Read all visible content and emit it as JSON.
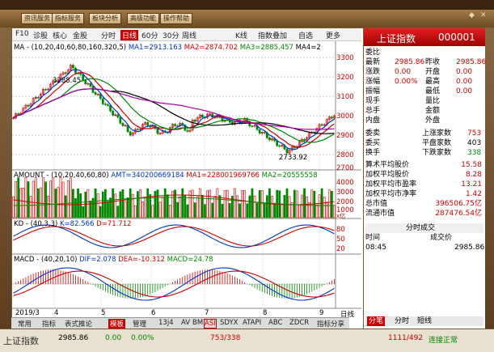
{
  "menu": [
    "资讯服务",
    "指标服务",
    "板块分析",
    "高级功能",
    "操作帮助"
  ],
  "toolbar": {
    "items": [
      "F10",
      "诊股",
      "核心",
      "金股",
      "分时",
      "日线",
      "60分",
      "30分",
      "周线",
      "K线",
      "指数叠加",
      "自选",
      "更多"
    ],
    "selected": "日线"
  },
  "ma_line": {
    "label": "MA - (10,20,40,60,80,160,320,5)",
    "ma1": "MA1=2913.163",
    "ma2": "MA2=2874.702",
    "ma3": "MA3=2885.457",
    "ma4": "MA4=2"
  },
  "price_axis": [
    "3300",
    "3200",
    "3100",
    "3000",
    "2900",
    "2800",
    "2700"
  ],
  "high_label": "3288.45",
  "low_label": "2733.92",
  "amount_line": {
    "label": "AMOUNT - (10,20,40,60,80)",
    "amt": "AMT=340200669184",
    "ma1": "MA1=228001969766",
    "ma2": "MA2=20555558"
  },
  "amount_axis": [
    "4000",
    "3000",
    "2000",
    "1000",
    "x亿"
  ],
  "kd_line": {
    "label": "KD - (40,3,3)",
    "k": "K=82.566",
    "d": "D=71.712"
  },
  "kd_axis": [
    "80",
    "50",
    "20"
  ],
  "macd_line": {
    "label": "MACD - (40,20,10)",
    "dif": "DIF=2.078",
    "dea": "DEA=-10.312",
    "macd": "MACD=24.78"
  },
  "x_labels": [
    "2019/3",
    "4",
    "5",
    "6",
    "7",
    "8",
    "9"
  ],
  "x_unit": "日线",
  "quote": {
    "title": "上证指数",
    "code": "000001",
    "weibi": "委比",
    "rows": [
      {
        "l1": "最新",
        "v1": "2985.86",
        "l2": "昨收",
        "v2": "2985.86"
      },
      {
        "l1": "涨跌",
        "v1": "0.00",
        "l2": "开盘",
        "v2": "0.00"
      },
      {
        "l1": "涨幅",
        "v1": "0.00%",
        "l2": "最高",
        "v2": "0.00"
      },
      {
        "l1": "振幅",
        "v1": "",
        "l2": "最低",
        "v2": "0.00"
      },
      {
        "l1": "现手",
        "v1": "",
        "l2": "量比",
        "v2": ""
      },
      {
        "l1": "总手",
        "v1": "",
        "l2": "金额",
        "v2": ""
      },
      {
        "l1": "内盘",
        "v1": "",
        "l2": "外盘",
        "v2": ""
      }
    ],
    "breadth": [
      {
        "l1": "委卖",
        "l2": "上涨家数",
        "v2": "753"
      },
      {
        "l1": "委买",
        "l2": "平盘家数",
        "v2": "403"
      },
      {
        "l1": "换手",
        "l2": "下跌家数",
        "v2": "338"
      }
    ],
    "stats": [
      {
        "l": "算术平均股价",
        "v": "15.58"
      },
      {
        "l": "加权平均股价",
        "v": "8.28"
      },
      {
        "l": "加权平均市盈率",
        "v": "13.21"
      },
      {
        "l": "加权平均市净率",
        "v": "1.42"
      },
      {
        "l": "总市值",
        "v": "396506.75亿"
      },
      {
        "l": "流通市值",
        "v": "287476.54亿"
      }
    ],
    "trade_title": "分时成交",
    "trade_head": {
      "time": "时间",
      "deal": "成交价"
    },
    "trade_row": {
      "time": "08:45",
      "deal": "2985.86"
    },
    "bottom_tabs": [
      "分笔",
      "分时",
      "短线"
    ]
  },
  "bottom_tabs": [
    "常用",
    "指标",
    "表式推论",
    "模板",
    "管理",
    "13j4",
    "AV",
    "BM",
    "ASI",
    "SDYX",
    "ATAPI",
    "ABC",
    "ZDCR",
    "指标分享"
  ],
  "status": {
    "label": "上证指数",
    "price": "2985.86",
    "change": "0.00",
    "pct": "0.00%",
    "updown": "753/338",
    "ratio": "1111/492",
    "conn": "连接正常"
  },
  "colors": {
    "bg": "#ffffff",
    "up": "#cc0000",
    "down": "#008800",
    "ma1": "#0033cc",
    "ma2": "#cc0000",
    "ma3": "#008800",
    "ma4": "#000000"
  }
}
